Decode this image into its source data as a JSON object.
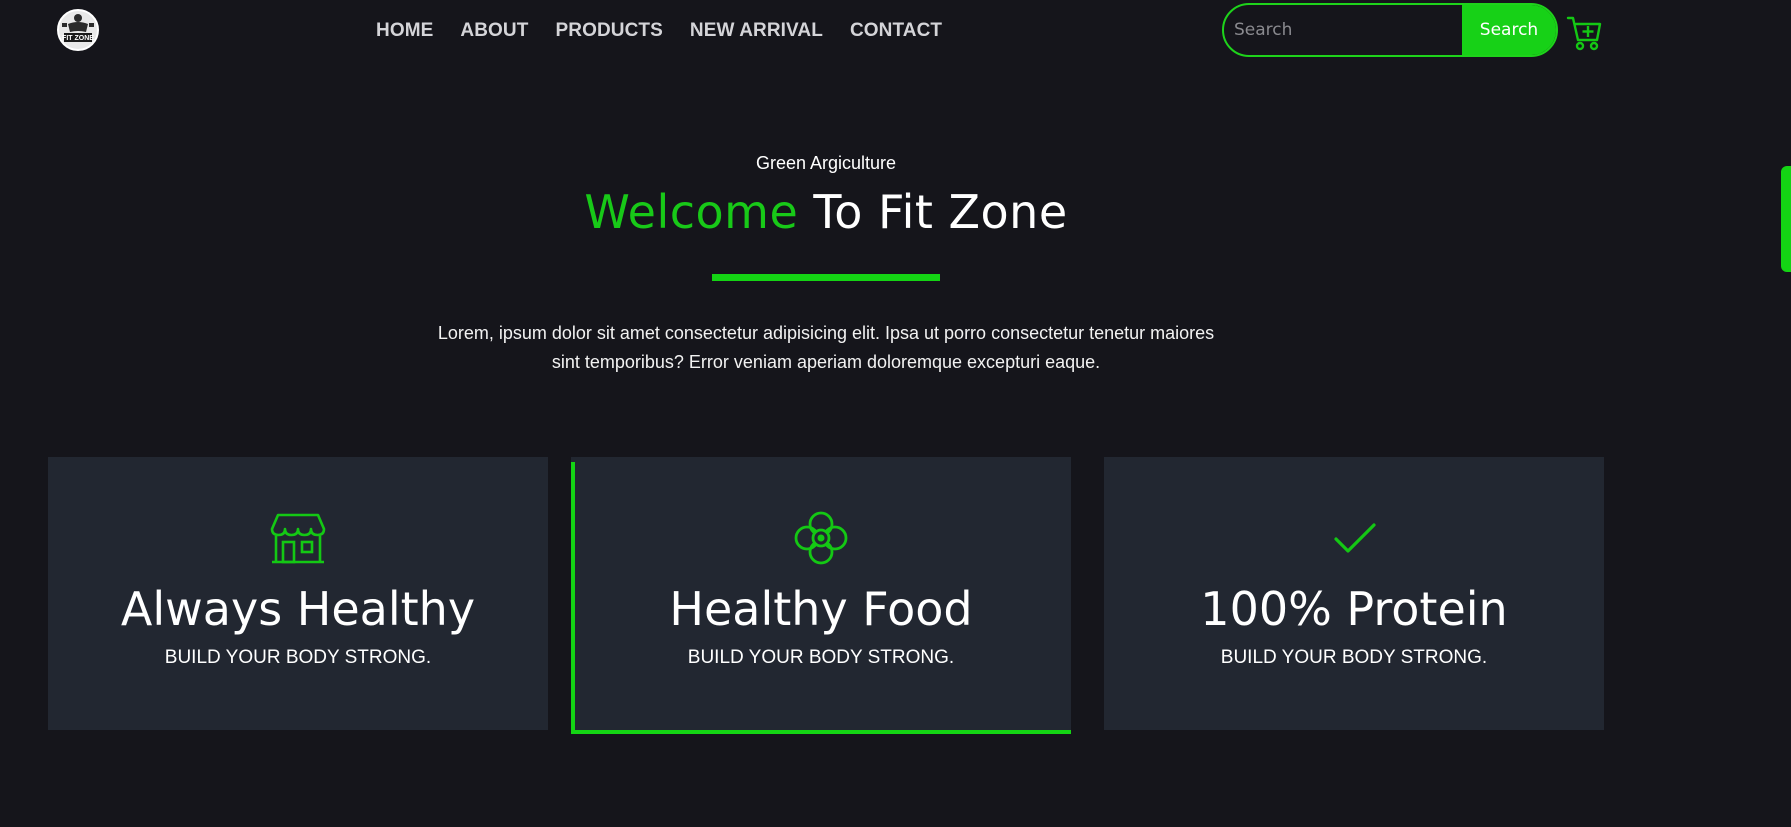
{
  "brand": {
    "logo_text": "FIT ZONE"
  },
  "nav": {
    "items": [
      {
        "label": "HOME"
      },
      {
        "label": "ABOUT"
      },
      {
        "label": "PRODUCTS"
      },
      {
        "label": "NEW ARRIVAL"
      },
      {
        "label": "CONTACT"
      }
    ]
  },
  "search": {
    "placeholder": "Search",
    "value": "",
    "button_label": "Search"
  },
  "cart": {
    "icon": "cart-plus-icon"
  },
  "hero": {
    "subtitle": "Green Argiculture",
    "title_accent": "Welcome",
    "title_rest": "To Fit Zone",
    "description": "Lorem, ipsum dolor sit amet consectetur adipisicing elit. Ipsa ut porro consectetur tenetur maiores sint temporibus? Error veniam aperiam doloremque excepturi eaque."
  },
  "features": [
    {
      "icon": "storefront-icon",
      "title": "Always Healthy",
      "subtitle": "BUILD YOUR BODY STRONG."
    },
    {
      "icon": "flower-icon",
      "title": "Healthy Food",
      "subtitle": "BUILD YOUR BODY STRONG."
    },
    {
      "icon": "checkmark-icon",
      "title": "100% Protein",
      "subtitle": "BUILD YOUR BODY STRONG."
    }
  ],
  "colors": {
    "background": "#15151b",
    "card": "#222731",
    "accent": "#14d414",
    "nav_text": "#d4d4d8"
  }
}
